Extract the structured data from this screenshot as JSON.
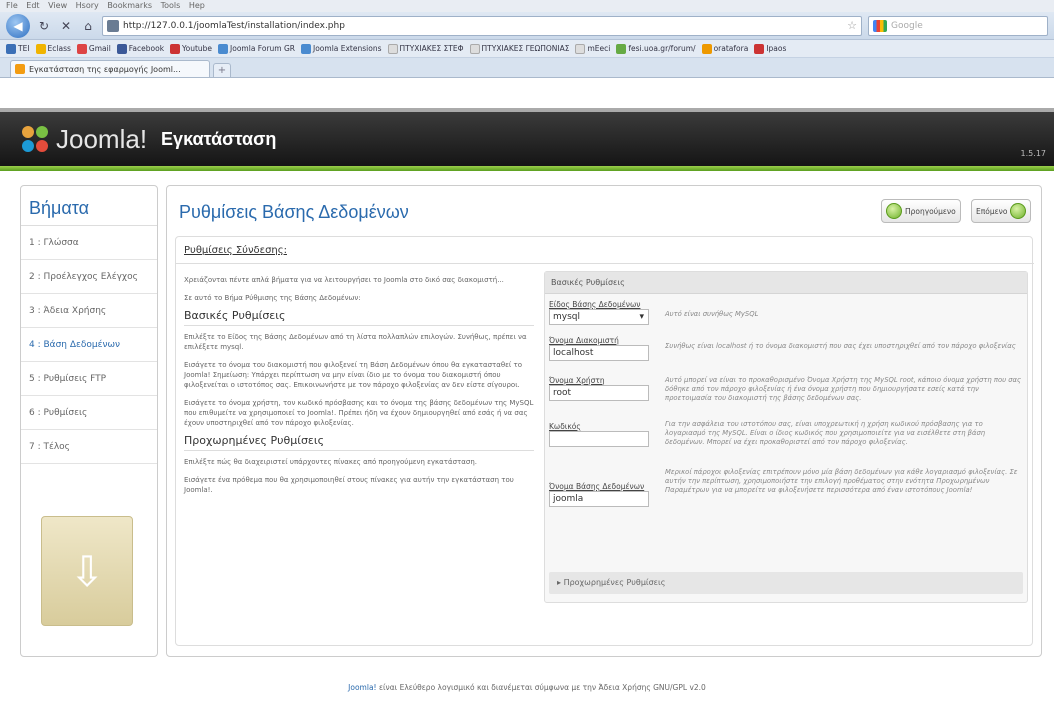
{
  "browser": {
    "menu": [
      "Fle",
      "Edt",
      "View",
      "Hsory",
      "Bookmarks",
      "Tools",
      "Hep"
    ],
    "url": "http://127.0.0.1/joomlaTest/installation/index.php",
    "search_placeholder": "Google",
    "bookmarks": [
      "TEI",
      "Eclass",
      "Gmail",
      "Facebook",
      "Youtube",
      "Joomla Forum GR",
      "Joomla Extensions",
      "ΠΤΥΧΙΑΚΕΣ ΣΤΕΦ",
      "ΠΤΥΧΙΑΚΕΣ ΓΕΩΠΟΝΙΑΣ",
      "mEeci",
      "fesi.uoa.gr/forum/",
      "oratafora",
      "Ipaos"
    ],
    "tab_title": "Εγκατάσταση της εφαρμογής Jooml..."
  },
  "header": {
    "logo_text": "Joomla!",
    "title": "Εγκατάσταση",
    "version": "1.5.17"
  },
  "steps": {
    "title": "Βήματα",
    "items": [
      "1 : Γλώσσα",
      "2 : Προέλεγχος Ελέγχος",
      "3 : Άδεια Χρήσης",
      "4 : Βάση Δεδομένων",
      "5 : Ρυθμίσεις FTP",
      "6 : Ρυθμίσεις",
      "7 : Τέλος"
    ]
  },
  "main": {
    "title": "Ρυθμίσεις Βάσης Δεδομένων",
    "prev_label": "Προηγούμενο",
    "next_label": "Επόμενο",
    "section_title": "Ρυθμίσεις Σύνδεσης:",
    "intro1": "Χρειάζονται πέντε απλά βήματα για να λειτουργήσει το Joomla στο δικό σας διακομιστή...",
    "intro2": "Σε αυτό το Βήμα Ρύθμισης της Βάσης Δεδομένων:",
    "basic_heading": "Βασικές Ρυθμίσεις",
    "basic_p1": "Επιλέξτε το Είδος της Βάσης Δεδομένων από τη λίστα πολλαπλών επιλογών. Συνήθως, πρέπει να επιλέξετε mysql.",
    "basic_p2": "Εισάγετε το όνομα του διακομιστή που φιλοξενεί τη Βάση Δεδομένων όπου θα εγκατασταθεί το Joomla! Σημείωση: Υπάρχει περίπτωση να μην είναι ίδιο με το όνομα του διακομιστή όπου φιλοξενείται ο ιστοτόπος σας. Επικοινωνήστε με τον πάροχο φιλοξενίας αν δεν είστε σίγουροι.",
    "basic_p3": "Εισάγετε το όνομα χρήστη, τον κωδικό πρόσβασης και το όνομα της βάσης δεδομένων της MySQL που επιθυμείτε να χρησιμοποιεί το Joomla!. Πρέπει ήδη να έχουν δημιουργηθεί από εσάς ή να σας έχουν υποστηριχθεί από τον πάροχο φιλοξενίας.",
    "adv_heading": "Προχωρημένες Ρυθμίσεις",
    "adv_p1": "Επιλέξτε πώς θα διαχειριστεί υπάρχοντες πίνακες από προηγούμενη εγκατάσταση.",
    "adv_p2": "Εισάγετε ένα πρόθεμα που θα χρησιμοποιηθεί στους πίνακες για αυτήν την εγκατάσταση του Joomla!.",
    "box_title": "Βασικές Ρυθμίσεις",
    "db_type_label": "Είδος Βάσης Δεδομένων",
    "db_type_value": "mysql",
    "db_type_help": "Αυτό είναι συνήθως MySQL",
    "host_label": "Όνομα Διακομιστή",
    "host_value": "localhost",
    "host_help": "Συνήθως είναι localhost ή το όνομα διακομιστή που σας έχει υποστηριχθεί από τον πάροχο φιλοξενίας",
    "user_label": "Όνομα Χρήστη",
    "user_value": "root",
    "user_help": "Αυτό μπορεί να είναι το προκαθορισμένο Όνομα Χρήστη της MySQL root, κάποιο όνομα χρήστη που σας δόθηκε από τον πάροχο φιλοξενίας ή ένα όνομα χρήστη που δημιουργήσατε εσείς κατά την προετοιμασία του διακομιστή της βάσης δεδομένων σας.",
    "pass_label": "Κωδικός",
    "pass_value": "",
    "pass_help": "Για την ασφάλεια του ιστοτόπου σας, είναι υποχρεωτική η χρήση κωδικού πρόσβασης για το λογαριασμό της MySQL. Είναι ο ίδιος κωδικός που χρησιμοποιείτε για να εισέλθετε στη βάση δεδομένων. Μπορεί να έχει προκαθοριστεί από τον πάροχο φιλοξενίας.",
    "dbname_label": "Όνομα Βάσης Δεδομένων",
    "dbname_value": "joomla",
    "dbname_help": "Μερικοί πάροχοι φιλοξενίας επιτρέπουν μόνο μία βάση δεδομένων για κάθε λογαριασμό φιλοξενίας. Σε αυτήν την περίπτωση, χρησιμοποιήστε την επιλογή προθέματος στην ενότητα Προχωρημένων Παραμέτρων για να μπορείτε να φιλοξενήσετε περισσότερα από έναν ιστοτόπους Joomla!",
    "advanced_label": "Προχωρημένες Ρυθμίσεις"
  },
  "footer": {
    "link": "Joomla!",
    "text": " είναι Ελεύθερο λογισμικό και διανέμεται σύμφωνα με την Άδεια Χρήσης GNU/GPL v2.0"
  }
}
